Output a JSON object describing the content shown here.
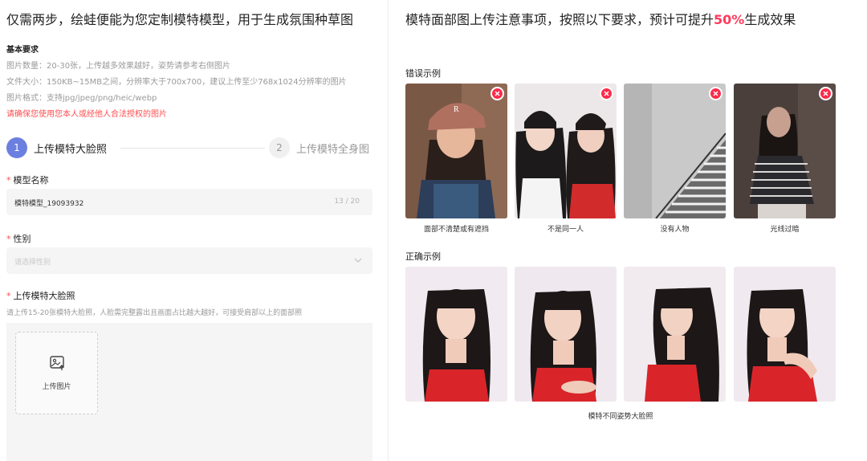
{
  "left": {
    "title": "仅需两步，绘蛙便能为您定制模特模型，用于生成氛围种草图",
    "requirements": {
      "heading": "基本要求",
      "lines": [
        "图片数量：20-30张，上传越多效果越好，姿势请参考右侧图片",
        "文件大小：150KB~15MB之间，分辨率大于700x700，建议上传至少768x1024分辨率的图片",
        "图片格式：支持jpg/jpeg/png/heic/webp"
      ],
      "warning": "请确保您使用您本人或经他人合法授权的图片"
    },
    "steps": [
      {
        "num": "1",
        "label": "上传模特大脸照"
      },
      {
        "num": "2",
        "label": "上传模特全身图"
      }
    ],
    "form": {
      "required_mark": "*",
      "name_label": "模型名称",
      "name_value": "模特模型_19093932",
      "name_count": "13 / 20",
      "gender_label": "性别",
      "gender_placeholder": "请选择性别",
      "photo_label": "上传模特大脸照",
      "photo_hint": "请上传15-20张模特大脸照，人脸需完整露出且画面占比越大越好，可接受肩部以上的面部照",
      "upload_text": "上传图片"
    }
  },
  "right": {
    "title_prefix": "模特面部图上传注意事项，按照以下要求，预计可提升",
    "title_highlight": "50%",
    "title_suffix": "生成效果",
    "wrong_label": "错误示例",
    "wrong_captions": [
      "面部不清楚或有遮挡",
      "不是同一人",
      "没有人物",
      "光线过暗"
    ],
    "right_label": "正确示例",
    "right_caption": "模特不同姿势大脸照"
  },
  "colors": {
    "accent": "#6b7fe0",
    "highlight": "#ff3b5c",
    "warning": "#ff4d4f",
    "error_badge": "#ff2b4a"
  },
  "icons": [
    "chevron-down-icon",
    "image-upload-icon",
    "close-icon"
  ]
}
